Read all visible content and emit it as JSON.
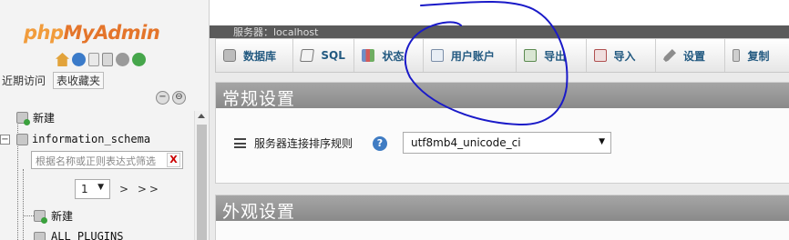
{
  "nav": {
    "logo_part1": "php",
    "logo_part2": "MyAdmin",
    "icons": [
      "home-icon",
      "help-icon",
      "docs-icon",
      "page-icon",
      "settings-gear-icon",
      "reload-icon"
    ],
    "tab_recent": "近期访问",
    "tab_favorites": "表收藏夹",
    "collapse_label": "−",
    "link_label": "⊖",
    "tree": {
      "new_label": "新建",
      "db_name": "information_schema",
      "expand_sign": "−",
      "filter_placeholder": "根据名称或正则表达式筛选",
      "filter_clear": "X",
      "page_value": "1",
      "page_nav": "> >>",
      "child_new": "新建",
      "child_table": "ALL_PLUGINS"
    }
  },
  "main": {
    "breadcrumb": "服务器：localhost",
    "menu": [
      {
        "icon": "database-icon",
        "label": "数据库"
      },
      {
        "icon": "sql-icon",
        "label": "SQL"
      },
      {
        "icon": "status-icon",
        "label": "状态"
      },
      {
        "icon": "user-accounts-icon",
        "label": "用户账户"
      },
      {
        "icon": "export-icon",
        "label": "导出"
      },
      {
        "icon": "import-icon",
        "label": "导入"
      },
      {
        "icon": "settings-icon",
        "label": "设置"
      },
      {
        "icon": "replication-icon",
        "label": "复制"
      }
    ],
    "general_settings": {
      "title": "常规设置",
      "collation_label": "服务器连接排序规则",
      "help": "?",
      "collation_value": "utf8mb4_unicode_ci"
    },
    "appearance_settings": {
      "title": "外观设置"
    }
  },
  "colors": {
    "accent_link": "#235a81",
    "panel_header": "#959595",
    "annotation_ink": "#1a1ac8"
  }
}
